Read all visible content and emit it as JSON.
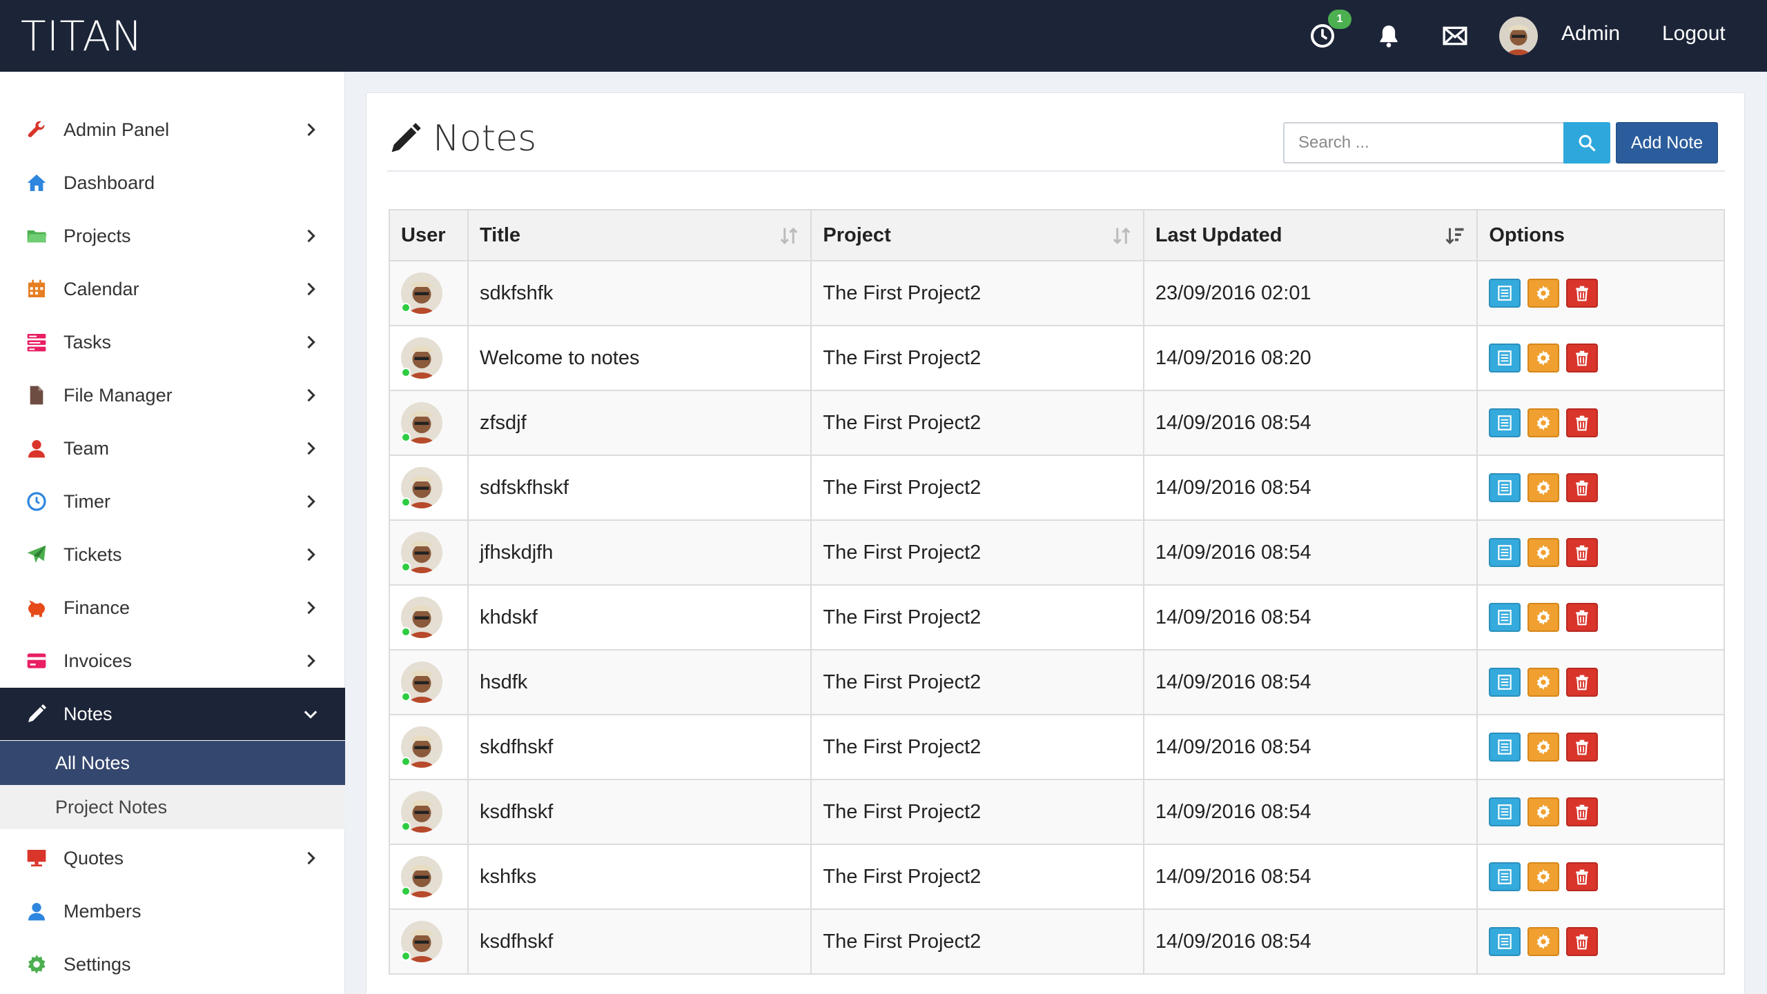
{
  "app": {
    "brand": "TITAN"
  },
  "topbar": {
    "timer_badge": "1",
    "user_name": "Admin",
    "logout_label": "Logout"
  },
  "sidebar": {
    "items": [
      {
        "label": "Admin Panel",
        "icon": "wrench-icon",
        "color": "#d9352b",
        "chevron": true
      },
      {
        "label": "Dashboard",
        "icon": "home-icon",
        "color": "#2e86de",
        "chevron": false
      },
      {
        "label": "Projects",
        "icon": "folder-icon",
        "color": "#4caf50",
        "chevron": true
      },
      {
        "label": "Calendar",
        "icon": "calendar-icon",
        "color": "#e67e22",
        "chevron": true
      },
      {
        "label": "Tasks",
        "icon": "tasks-icon",
        "color": "#e91e63",
        "chevron": true
      },
      {
        "label": "File Manager",
        "icon": "file-icon",
        "color": "#6d4c41",
        "chevron": true
      },
      {
        "label": "Team",
        "icon": "user-icon",
        "color": "#d9352b",
        "chevron": true
      },
      {
        "label": "Timer",
        "icon": "clock-icon",
        "color": "#2e86de",
        "chevron": true
      },
      {
        "label": "Tickets",
        "icon": "paper-plane-icon",
        "color": "#4caf50",
        "chevron": true
      },
      {
        "label": "Finance",
        "icon": "piggy-bank-icon",
        "color": "#e64a19",
        "chevron": true
      },
      {
        "label": "Invoices",
        "icon": "credit-card-icon",
        "color": "#e91e63",
        "chevron": true
      },
      {
        "label": "Notes",
        "icon": "pencil-icon",
        "color": "#ffffff",
        "chevron": true
      },
      {
        "label": "Quotes",
        "icon": "monitor-icon",
        "color": "#d9352b",
        "chevron": true
      },
      {
        "label": "Members",
        "icon": "user-icon",
        "color": "#2e86de",
        "chevron": false
      },
      {
        "label": "Settings",
        "icon": "gear-icon",
        "color": "#4caf50",
        "chevron": false
      }
    ],
    "notes_sub": [
      {
        "label": "All Notes"
      },
      {
        "label": "Project Notes"
      }
    ]
  },
  "main": {
    "title": "Notes",
    "search_placeholder": "Search ...",
    "add_button": "Add Note",
    "table": {
      "columns": [
        "User",
        "Title",
        "Project",
        "Last Updated",
        "Options"
      ],
      "rows": [
        {
          "title": "sdkfshfk",
          "project": "The First Project2",
          "updated": "23/09/2016 02:01"
        },
        {
          "title": "Welcome to notes",
          "project": "The First Project2",
          "updated": "14/09/2016 08:20"
        },
        {
          "title": "zfsdjf",
          "project": "The First Project2",
          "updated": "14/09/2016 08:54"
        },
        {
          "title": "sdfskfhskf",
          "project": "The First Project2",
          "updated": "14/09/2016 08:54"
        },
        {
          "title": "jfhskdjfh",
          "project": "The First Project2",
          "updated": "14/09/2016 08:54"
        },
        {
          "title": "khdskf",
          "project": "The First Project2",
          "updated": "14/09/2016 08:54"
        },
        {
          "title": "hsdfk",
          "project": "The First Project2",
          "updated": "14/09/2016 08:54"
        },
        {
          "title": "skdfhskf",
          "project": "The First Project2",
          "updated": "14/09/2016 08:54"
        },
        {
          "title": "ksdfhskf",
          "project": "The First Project2",
          "updated": "14/09/2016 08:54"
        },
        {
          "title": "kshfks",
          "project": "The First Project2",
          "updated": "14/09/2016 08:54"
        },
        {
          "title": "ksdfhskf",
          "project": "The First Project2",
          "updated": "14/09/2016 08:54"
        }
      ]
    }
  }
}
